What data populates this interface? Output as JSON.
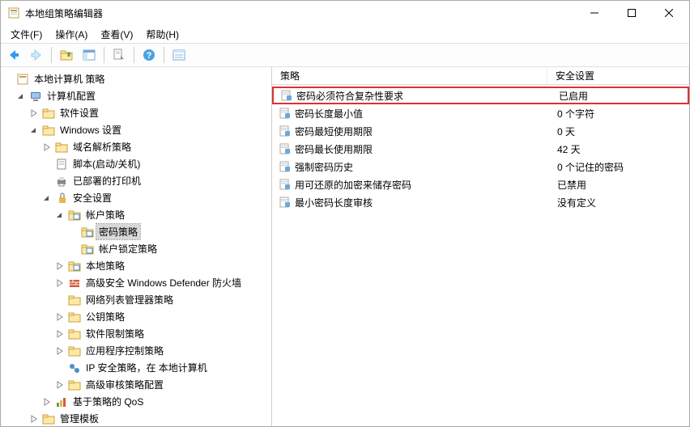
{
  "window": {
    "title": "本地组策略编辑器"
  },
  "menu": {
    "file": "文件(F)",
    "action": "操作(A)",
    "view": "查看(V)",
    "help": "帮助(H)"
  },
  "columns": {
    "policy": "策略",
    "setting": "安全设置"
  },
  "policies": [
    {
      "name": "密码必须符合复杂性要求",
      "value": "已启用",
      "highlight": true
    },
    {
      "name": "密码长度最小值",
      "value": "0 个字符"
    },
    {
      "name": "密码最短使用期限",
      "value": "0 天"
    },
    {
      "name": "密码最长使用期限",
      "value": "42 天"
    },
    {
      "name": "强制密码历史",
      "value": "0 个记住的密码"
    },
    {
      "name": "用可还原的加密来储存密码",
      "value": "已禁用"
    },
    {
      "name": "最小密码长度审核",
      "value": "没有定义"
    }
  ],
  "tree": {
    "root": "本地计算机 策略",
    "computer_config": "计算机配置",
    "software_settings": "软件设置",
    "windows_settings": "Windows 设置",
    "dns_policy": "域名解析策略",
    "scripts": "脚本(启动/关机)",
    "printers": "已部署的打印机",
    "security_settings": "安全设置",
    "account_policies": "帐户策略",
    "password_policy": "密码策略",
    "lockout_policy": "帐户锁定策略",
    "local_policies": "本地策略",
    "defender_firewall": "高级安全 Windows Defender 防火墙",
    "network_list": "网络列表管理器策略",
    "public_key": "公钥策略",
    "software_restriction": "软件限制策略",
    "app_control": "应用程序控制策略",
    "ip_security": "IP 安全策略，在 本地计算机",
    "audit_config": "高级审核策略配置",
    "qos": "基于策略的 QoS",
    "admin_templates": "管理模板"
  }
}
